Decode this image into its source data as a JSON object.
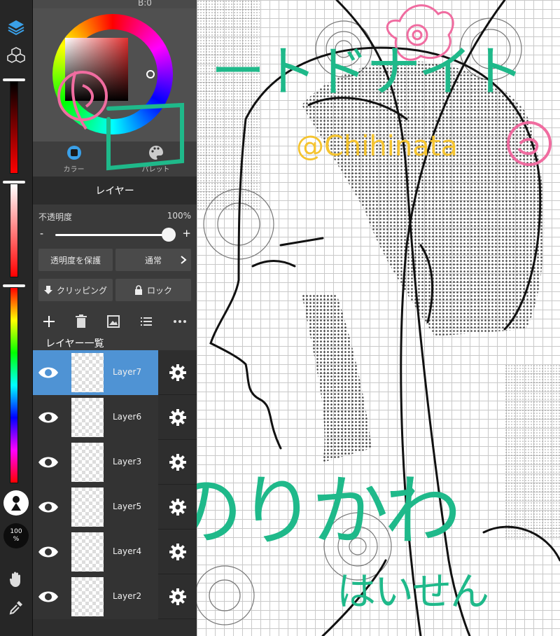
{
  "toolbar": {
    "icons": [
      "layers-icon",
      "3d-material-icon",
      "hand-icon",
      "eyedropper-icon"
    ],
    "brush_size_label": "",
    "zoom_value": "100",
    "zoom_unit": "%"
  },
  "color_panel": {
    "rgb_readout": "B:0",
    "tabs": [
      {
        "label": "カラー",
        "icon": "color-circle-icon"
      },
      {
        "label": "パレット",
        "icon": "palette-icon"
      }
    ],
    "current_color": "#e23030"
  },
  "layer_panel": {
    "title": "レイヤー",
    "opacity_label": "不透明度",
    "opacity_value": "100%",
    "opacity_fraction": 1.0,
    "protect_alpha_label": "透明度を保護",
    "blend_mode_label": "通常",
    "clipping_label": "クリッピング",
    "lock_label": "ロック",
    "list_title": "レイヤー一覧",
    "layers": [
      {
        "name": "Layer7",
        "selected": true
      },
      {
        "name": "Layer6",
        "selected": false
      },
      {
        "name": "Layer3",
        "selected": false
      },
      {
        "name": "Layer5",
        "selected": false
      },
      {
        "name": "Layer4",
        "selected": false
      },
      {
        "name": "Layer2",
        "selected": false
      }
    ]
  },
  "canvas": {
    "title_text": "ートドナイト",
    "artist_handle": "@Chihinata",
    "main_text": "みのりかわ",
    "sub_text": "はいせん",
    "accent_green": "#1fb98a",
    "accent_pink": "#f06ca0",
    "accent_yellow": "#f5c430"
  }
}
